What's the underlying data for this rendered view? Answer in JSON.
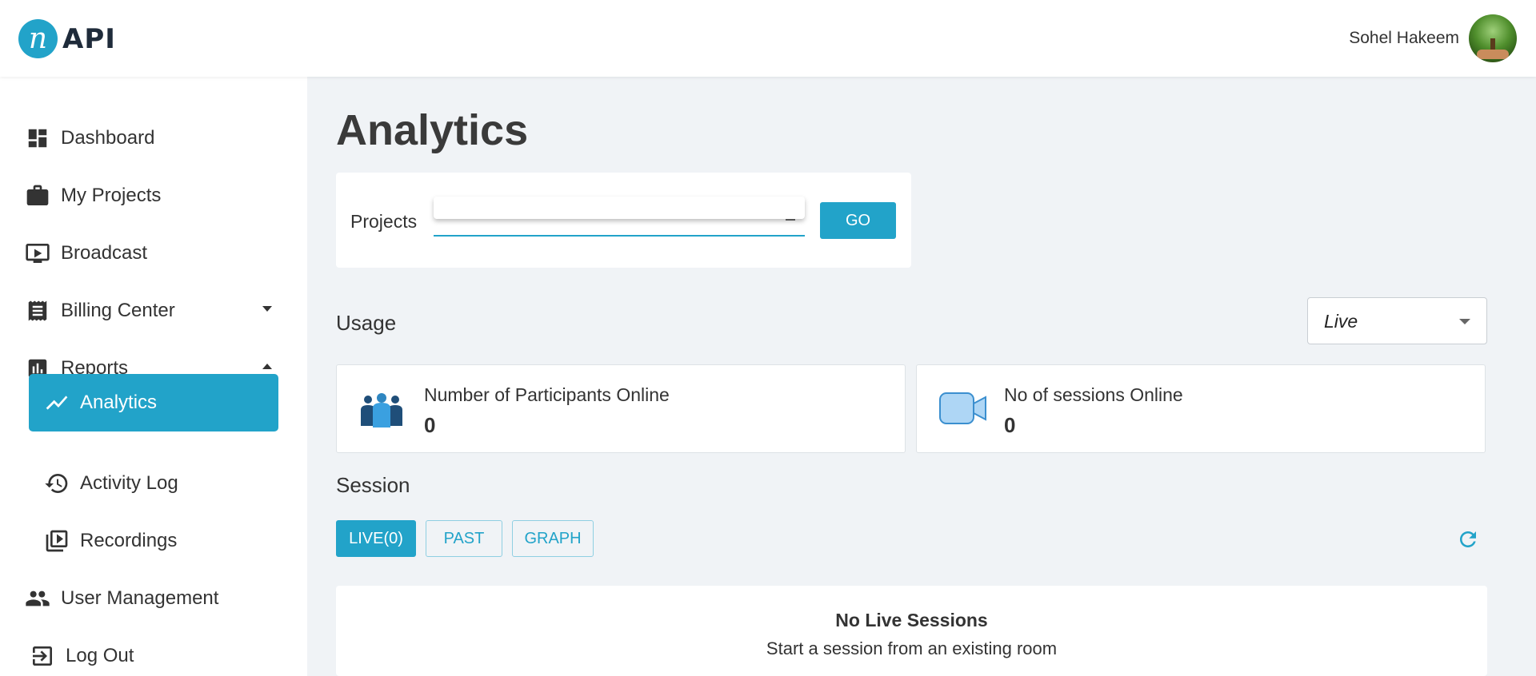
{
  "header": {
    "logo_mark": "n",
    "logo_text": "API",
    "user_name": "Sohel Hakeem"
  },
  "sidebar": {
    "items": [
      {
        "label": "Dashboard",
        "icon": "dashboard-icon"
      },
      {
        "label": "My Projects",
        "icon": "briefcase-icon"
      },
      {
        "label": "Broadcast",
        "icon": "tv-play-icon"
      },
      {
        "label": "Billing Center",
        "icon": "receipt-icon"
      },
      {
        "label": "Reports",
        "icon": "bar-chart-icon"
      },
      {
        "label": "Analytics",
        "icon": "trending-icon"
      },
      {
        "label": "Activity Log",
        "icon": "history-icon"
      },
      {
        "label": "Recordings",
        "icon": "video-library-icon"
      },
      {
        "label": "User Management",
        "icon": "people-icon"
      },
      {
        "label": "Log Out",
        "icon": "logout-icon"
      }
    ]
  },
  "main": {
    "title": "Analytics",
    "projects": {
      "label": "Projects",
      "selected": "",
      "go_label": "GO"
    },
    "usage": {
      "title": "Usage",
      "filter_value": "Live",
      "cards": [
        {
          "label": "Number of Participants Online",
          "value": "0",
          "icon": "participants-icon"
        },
        {
          "label": "No of sessions Online",
          "value": "0",
          "icon": "video-camera-icon"
        }
      ]
    },
    "session": {
      "title": "Session",
      "tabs": [
        {
          "label": "LIVE(0)",
          "active": true
        },
        {
          "label": "PAST",
          "active": false
        },
        {
          "label": "GRAPH",
          "active": false
        }
      ],
      "empty_title": "No Live Sessions",
      "empty_subtitle": "Start a session from an existing room"
    }
  },
  "colors": {
    "accent": "#22a3c9",
    "background": "#f0f3f6",
    "text": "#333333"
  }
}
